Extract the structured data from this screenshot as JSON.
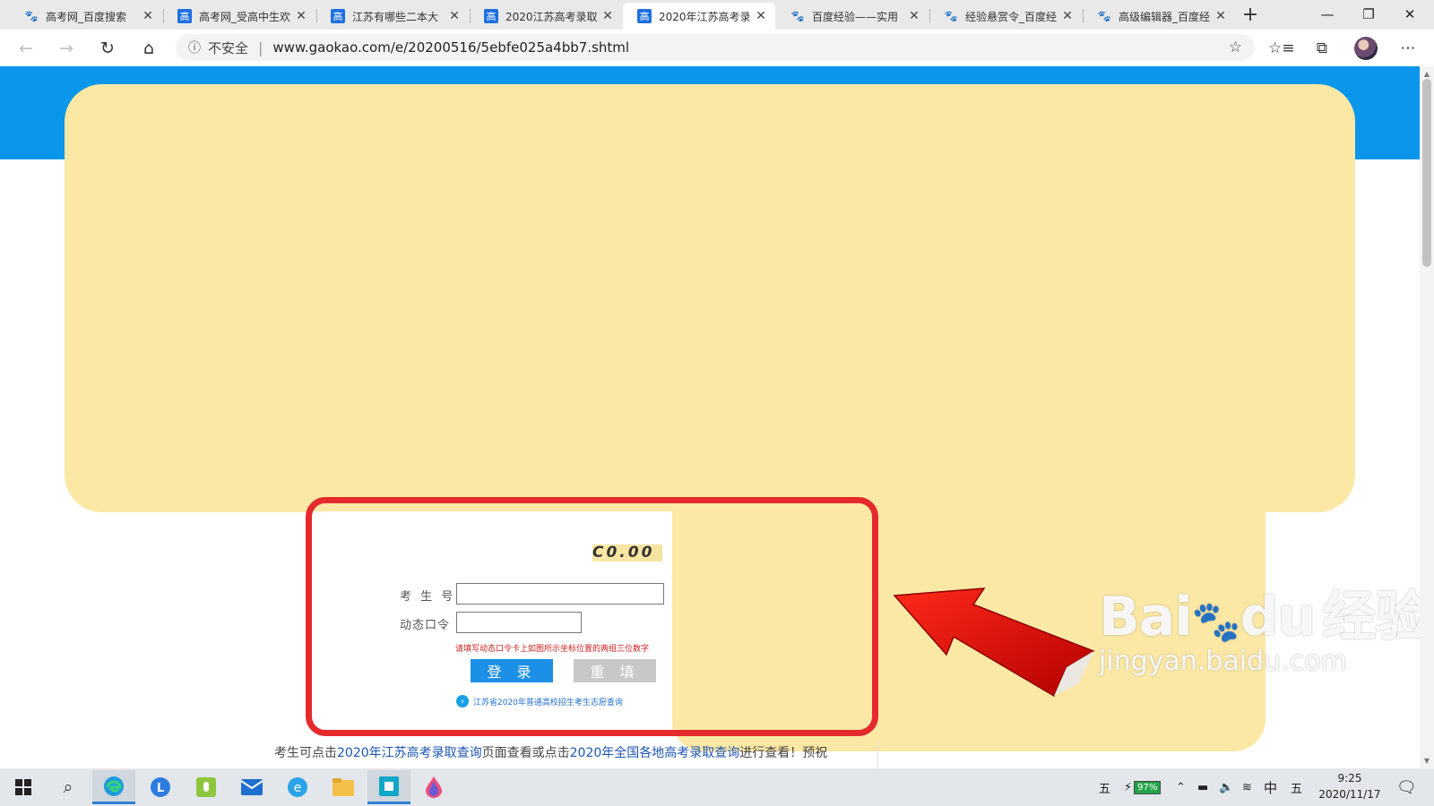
{
  "browser": {
    "tabs": [
      {
        "title": "高考网_百度搜索",
        "favicon": "baidu-paw-icon",
        "active": false
      },
      {
        "title": "高考网_受高中生欢",
        "favicon": "gaokao-favicon",
        "active": false
      },
      {
        "title": "江苏有哪些二本大",
        "favicon": "gaokao-favicon",
        "active": false
      },
      {
        "title": "2020江苏高考录取",
        "favicon": "gaokao-favicon",
        "active": false
      },
      {
        "title": "2020年江苏高考录",
        "favicon": "gaokao-favicon",
        "active": true
      },
      {
        "title": "百度经验——实用",
        "favicon": "baidu-paw-icon",
        "active": false
      },
      {
        "title": "经验悬赏令_百度经",
        "favicon": "baidu-paw-icon",
        "active": false
      },
      {
        "title": "高级编辑器_百度经",
        "favicon": "baidu-paw-icon",
        "active": false
      }
    ],
    "gao_glyph": "高",
    "new_tab": "+",
    "address": {
      "security_label": "不安全",
      "separator": "|",
      "url": "www.gaokao.com/e/20200516/5ebfe025a4bb7.shtml"
    }
  },
  "login_form": {
    "exam_number_label": "考 生 号",
    "dynamic_code_label": "动态口令",
    "captcha_text": "C0.00",
    "hint": "请填写动态口令卡上如图所示坐标位置的两组三位数字",
    "login_button": "登 录",
    "reset_button": "重 填",
    "query_link": "江苏省2020年普通高校招生考生志愿查询"
  },
  "body_text": {
    "part1": "考生可点击",
    "link1": "2020年江苏高考录取查询",
    "part2": "页面查看或点击",
    "link2": "2020年全国各地高考录取查询",
    "part3": "进行查看！预祝"
  },
  "watermark": {
    "brand": "Bai",
    "brand2": "du",
    "brand_cn": "经验",
    "url": "jingyan.baidu.com"
  },
  "taskbar": {
    "tray_ime": "五",
    "battery": "97%",
    "lang": "中",
    "ime2": "五",
    "time": "9:25",
    "date": "2020/11/17"
  },
  "colors": {
    "blue_band": "#0a96ea",
    "yellow_overlay": "#fbe8a4",
    "highlight_red": "#e52a2d",
    "login_blue": "#1c8fe6"
  }
}
